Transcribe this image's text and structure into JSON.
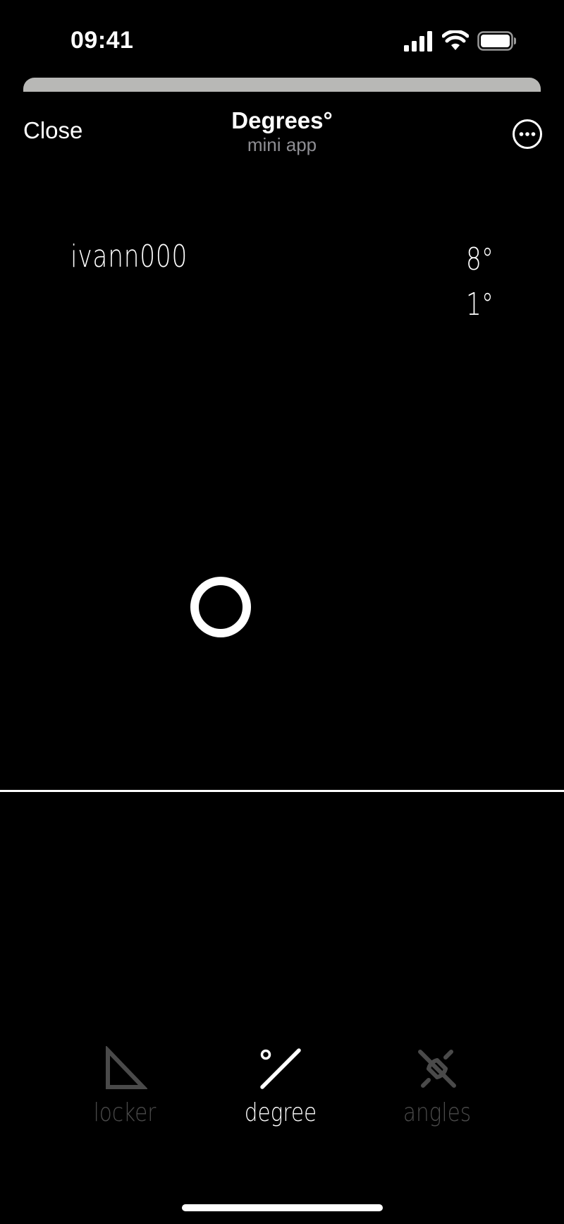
{
  "status_bar": {
    "time": "09:41"
  },
  "header": {
    "close_label": "Close",
    "title": "Degrees°",
    "subtitle": "mini app",
    "more_icon": "ellipsis-circle-icon"
  },
  "content": {
    "username": "ivann000",
    "degree_primary": "8°",
    "degree_secondary": "1°"
  },
  "tabs": [
    {
      "label": "locker",
      "icon": "triangle-ruler-icon",
      "active": false
    },
    {
      "label": "degree",
      "icon": "degree-slash-icon",
      "active": true
    },
    {
      "label": "angles",
      "icon": "crossed-lines-icon",
      "active": false
    }
  ],
  "colors": {
    "background": "#000000",
    "foreground": "#ffffff",
    "inactive": "#4a4a4a",
    "subtitle": "#8e8e93",
    "sheet_edge": "#b8b8b6"
  }
}
